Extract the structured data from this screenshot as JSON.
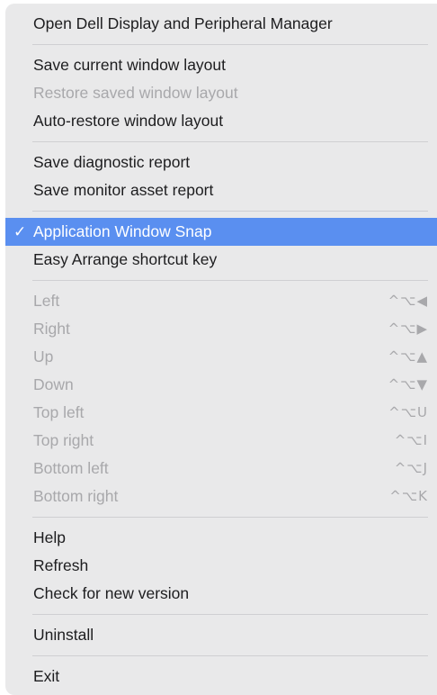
{
  "menu": {
    "sections": [
      [
        {
          "label": "Open Dell Display and Peripheral Manager",
          "state": "enabled"
        }
      ],
      [
        {
          "label": "Save current window layout",
          "state": "enabled"
        },
        {
          "label": "Restore saved window layout",
          "state": "disabled"
        },
        {
          "label": "Auto-restore window layout",
          "state": "enabled"
        }
      ],
      [
        {
          "label": "Save diagnostic report",
          "state": "enabled"
        },
        {
          "label": "Save monitor asset report",
          "state": "enabled"
        }
      ],
      [
        {
          "label": "Application Window Snap",
          "state": "selected",
          "checked": true,
          "check_mark": "✓"
        },
        {
          "label": "Easy Arrange shortcut key",
          "state": "enabled"
        }
      ],
      [
        {
          "label": "Left",
          "state": "disabled",
          "shortcut": "^⌥◀"
        },
        {
          "label": "Right",
          "state": "disabled",
          "shortcut": "^⌥▶"
        },
        {
          "label": "Up",
          "state": "disabled",
          "shortcut": "^⌥▲"
        },
        {
          "label": "Down",
          "state": "disabled",
          "shortcut": "^⌥▼"
        },
        {
          "label": "Top left",
          "state": "disabled",
          "shortcut": "^⌥U"
        },
        {
          "label": "Top right",
          "state": "disabled",
          "shortcut": "^⌥I"
        },
        {
          "label": "Bottom left",
          "state": "disabled",
          "shortcut": "^⌥J"
        },
        {
          "label": "Bottom right",
          "state": "disabled",
          "shortcut": "^⌥K"
        }
      ],
      [
        {
          "label": "Help",
          "state": "enabled"
        },
        {
          "label": "Refresh",
          "state": "enabled"
        },
        {
          "label": "Check for new version",
          "state": "enabled"
        }
      ],
      [
        {
          "label": "Uninstall",
          "state": "enabled"
        }
      ],
      [
        {
          "label": "Exit",
          "state": "enabled"
        }
      ]
    ]
  },
  "colors": {
    "menu_background": "#e9e9ea",
    "selection": "#5a8ff0",
    "text": "#1d1d1f",
    "disabled_text": "#a8a8ab",
    "separator": "#cfcfd2"
  }
}
